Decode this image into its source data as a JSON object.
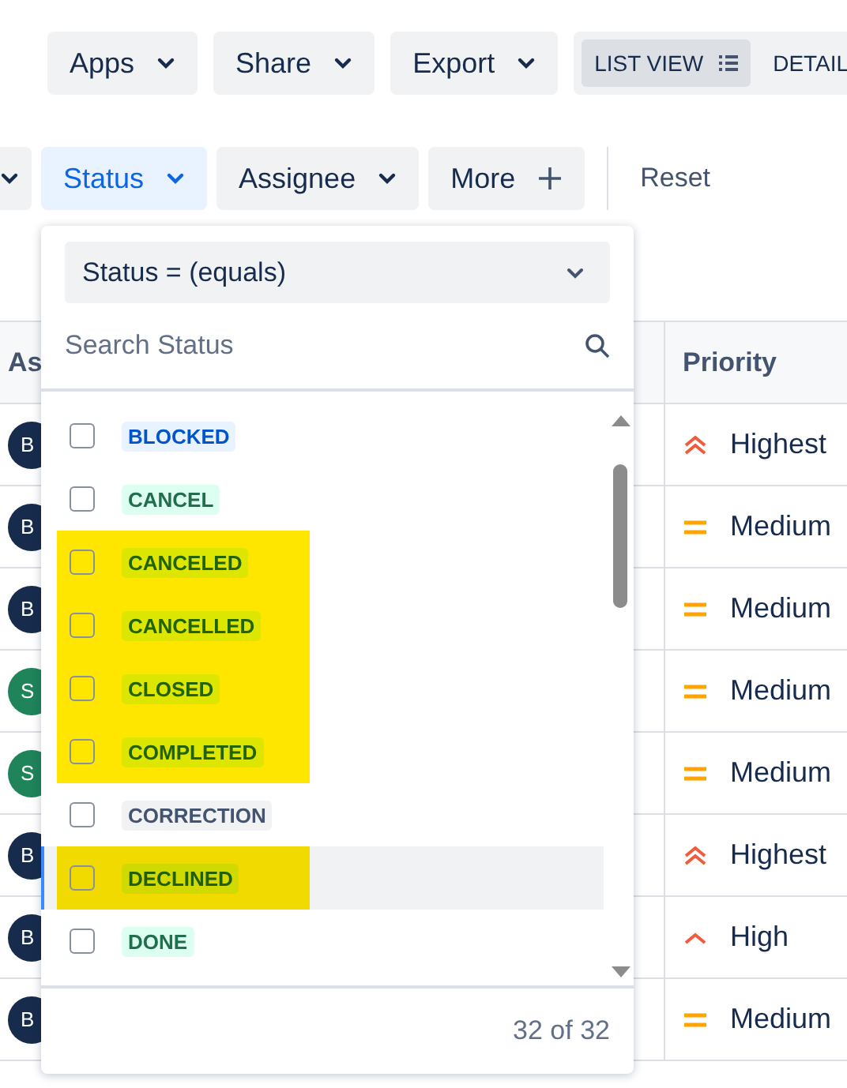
{
  "toolbar": [
    {
      "label": "Apps"
    },
    {
      "label": "Share"
    },
    {
      "label": "Export"
    }
  ],
  "views": [
    {
      "label": "LIST VIEW",
      "selected": true
    },
    {
      "label": "DETAIL",
      "selected": false
    }
  ],
  "filters": [
    {
      "selected": false
    },
    {
      "label": "Status",
      "selected": true
    },
    {
      "label": "Assignee",
      "selected": false
    }
  ],
  "more_button": "More",
  "reset": "Reset",
  "table": {
    "columns": [
      "As",
      "Priority"
    ],
    "rows": [
      {
        "initials": "B",
        "color": "#172b4d",
        "priority": "Highest",
        "kind": "highest"
      },
      {
        "initials": "B",
        "color": "#172b4d",
        "priority": "Medium",
        "kind": "medium"
      },
      {
        "initials": "B",
        "color": "#172b4d",
        "priority": "Medium",
        "kind": "medium"
      },
      {
        "initials": "S",
        "color": "#1f845a",
        "priority": "Medium",
        "kind": "medium"
      },
      {
        "initials": "S",
        "color": "#1f845a",
        "priority": "Medium",
        "kind": "medium"
      },
      {
        "initials": "B",
        "color": "#172b4d",
        "priority": "Highest",
        "kind": "highest"
      },
      {
        "initials": "B",
        "color": "#172b4d",
        "priority": "High",
        "kind": "high"
      },
      {
        "initials": "B",
        "color": "#172b4d",
        "priority": "Medium",
        "kind": "medium"
      }
    ]
  },
  "dropdown": {
    "operator": "Status = (equals)",
    "search": {
      "placeholder": "Search Status"
    },
    "items": [
      {
        "label": "BLOCKED",
        "kind": "inprogress",
        "checked": false,
        "highlighted": false,
        "focused": false
      },
      {
        "label": "CANCEL",
        "kind": "done",
        "checked": false,
        "highlighted": false,
        "focused": false
      },
      {
        "label": "CANCELED",
        "kind": "done",
        "checked": false,
        "highlighted": true,
        "focused": false
      },
      {
        "label": "CANCELLED",
        "kind": "done",
        "checked": false,
        "highlighted": true,
        "focused": false
      },
      {
        "label": "CLOSED",
        "kind": "done",
        "checked": false,
        "highlighted": true,
        "focused": false
      },
      {
        "label": "COMPLETED",
        "kind": "done",
        "checked": false,
        "highlighted": true,
        "focused": false
      },
      {
        "label": "CORRECTION",
        "kind": "todo",
        "checked": false,
        "highlighted": false,
        "focused": false
      },
      {
        "label": "DECLINED",
        "kind": "done",
        "checked": false,
        "highlighted": true,
        "focused": true
      },
      {
        "label": "DONE",
        "kind": "done",
        "checked": false,
        "highlighted": false,
        "focused": false
      }
    ],
    "count": "32 of 32"
  }
}
